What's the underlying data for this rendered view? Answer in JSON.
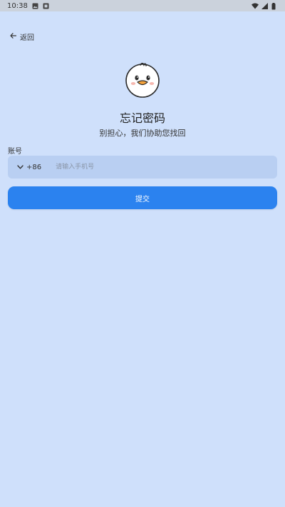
{
  "status_bar": {
    "time": "10:38",
    "left_icons": [
      "image-icon",
      "notification-icon"
    ],
    "right_icons": [
      "wifi-icon",
      "signal-icon",
      "battery-icon"
    ]
  },
  "nav": {
    "back_label": "返回"
  },
  "header": {
    "title": "忘记密码",
    "subtitle": "别担心，我们协助您找回"
  },
  "form": {
    "account_label": "账号",
    "country_code": "+86",
    "phone_placeholder": "请输入手机号",
    "phone_value": "",
    "submit_label": "提交"
  },
  "colors": {
    "background": "#cfe0fb",
    "input_bg": "#b9cff2",
    "accent": "#2b82ef",
    "status_bar": "#cbd2dc"
  }
}
